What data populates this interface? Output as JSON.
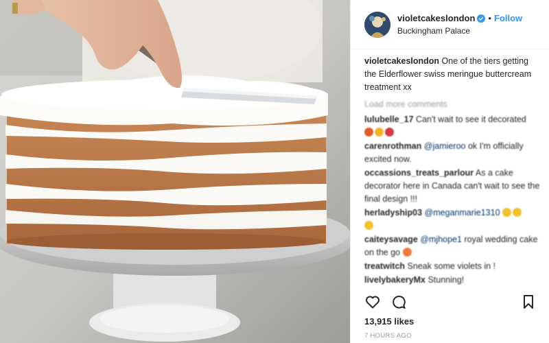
{
  "post": {
    "username": "violetcakeslondon",
    "separator": "•",
    "follow_label": "Follow",
    "location": "Buckingham Palace",
    "caption_user": "violetcakeslondon",
    "caption_text": "One of the tiers getting the Elderflower swiss meringue buttercream treatment xx",
    "load_more": "Load more comments",
    "likes": "13,915 likes",
    "time": "7 HOURS AGO"
  },
  "comments": [
    {
      "user": "lulubelle_17",
      "text": "Can't wait to see it decorated"
    },
    {
      "user": "carenrothman",
      "mention": "@jamieroo",
      "text": "ok I'm officially excited now."
    },
    {
      "user": "occassions_treats_parlour",
      "text": "As a cake decorator here in Canada can't wait to see the final design !!!"
    },
    {
      "user": "herladyship03",
      "mention": "@meganmarie1310"
    },
    {
      "user": "caiteysavage",
      "mention": "@mjhope1",
      "text": "royal wedding cake on the go"
    },
    {
      "user": "treatwitch",
      "text": "Sneak some violets in !"
    },
    {
      "user": "livelybakeryMx",
      "text": "Stunning!"
    }
  ],
  "icons": {
    "verified": "verified-badge-icon",
    "like": "heart-icon",
    "comment": "comment-bubble-icon",
    "save": "bookmark-icon"
  },
  "colors": {
    "follow": "#3897f0",
    "verified": "#3897f0",
    "muted": "#999999"
  }
}
